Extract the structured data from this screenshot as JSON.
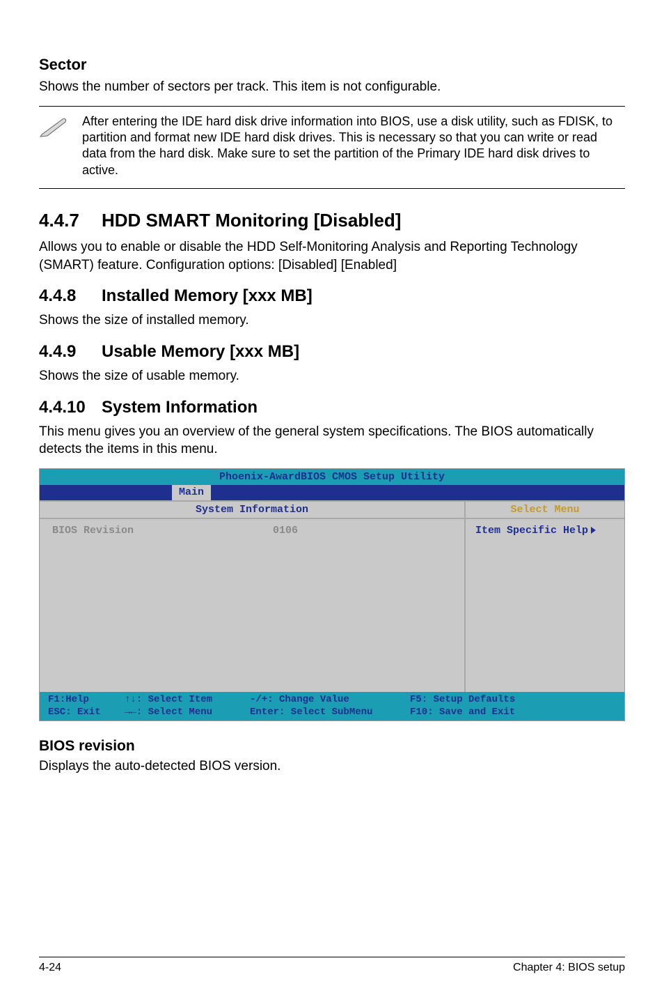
{
  "sector": {
    "heading": "Sector",
    "body": "Shows the number of sectors per track. This item is not configurable."
  },
  "note": {
    "text": "After entering the IDE hard disk drive information into BIOS, use a disk utility, such as FDISK, to partition and format new IDE hard disk drives. This is necessary so that you can write or read data from the hard disk. Make sure to set the partition of the Primary IDE hard disk drives to active."
  },
  "s447": {
    "num": "4.4.7",
    "title": "HDD SMART Monitoring [Disabled]",
    "body": "Allows you to enable or disable the HDD Self-Monitoring Analysis and Reporting Technology (SMART) feature. Configuration options: [Disabled] [Enabled]"
  },
  "s448": {
    "num": "4.4.8",
    "title": "Installed Memory [xxx MB]",
    "body": "Shows the size of installed memory."
  },
  "s449": {
    "num": "4.4.9",
    "title": "Usable Memory [xxx MB]",
    "body": "Shows the size of usable memory."
  },
  "s4410": {
    "num": "4.4.10",
    "title": "System Information",
    "body": "This menu gives you an overview of the general system specifications. The BIOS automatically detects the items in this menu."
  },
  "bios": {
    "title": "Phoenix-AwardBIOS CMOS Setup Utility",
    "tab": "Main",
    "left_header": "System Information",
    "right_header": "Select Menu",
    "row_label": "BIOS Revision",
    "row_value": "0106",
    "help_label": "Item Specific Help",
    "footer": {
      "f1": "F1:Help",
      "esc": "ESC: Exit",
      "sel_item": "↑↓: Select Item",
      "sel_menu": "→←: Select Menu",
      "change": "-/+: Change Value",
      "enter": "Enter: Select SubMenu",
      "f5": "F5: Setup Defaults",
      "f10": "F10: Save and Exit"
    }
  },
  "bios_rev": {
    "heading": "BIOS revision",
    "body": "Displays the auto-detected BIOS version."
  },
  "footer": {
    "left": "4-24",
    "right": "Chapter 4: BIOS setup"
  }
}
